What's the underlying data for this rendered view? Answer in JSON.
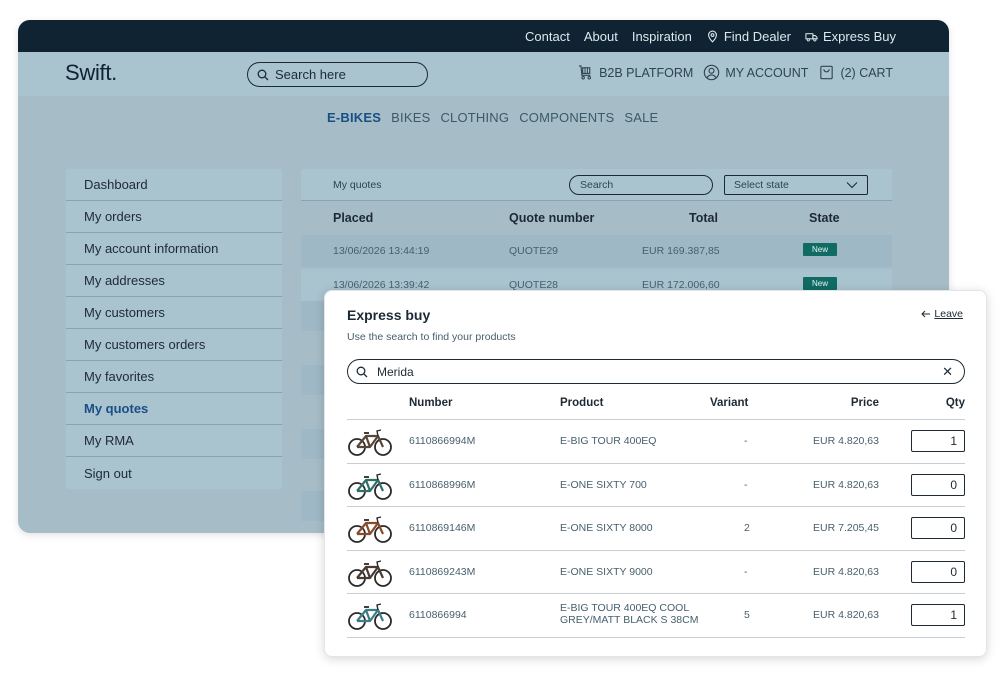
{
  "topnav": {
    "links": [
      {
        "label": "Contact",
        "icon": ""
      },
      {
        "label": "About",
        "icon": ""
      },
      {
        "label": "Inspiration",
        "icon": ""
      },
      {
        "label": "Find Dealer",
        "icon": "location-pin-icon"
      },
      {
        "label": "Express Buy",
        "icon": "truck-icon"
      }
    ]
  },
  "header": {
    "logo": "Swift.",
    "search_placeholder": "Search here",
    "b2b_label": "B2B PLATFORM",
    "account_label": "MY ACCOUNT",
    "cart_label": "(2) CART"
  },
  "categories": [
    {
      "label": "E-BIKES",
      "active": true
    },
    {
      "label": "BIKES",
      "active": false
    },
    {
      "label": "CLOTHING",
      "active": false
    },
    {
      "label": "COMPONENTS",
      "active": false
    },
    {
      "label": "SALE",
      "active": false
    }
  ],
  "sidebar": {
    "items": [
      {
        "label": "Dashboard"
      },
      {
        "label": "My orders"
      },
      {
        "label": "My account information"
      },
      {
        "label": "My addresses"
      },
      {
        "label": "My customers"
      },
      {
        "label": "My customers orders"
      },
      {
        "label": "My favorites"
      },
      {
        "label": "My quotes",
        "active": true
      },
      {
        "label": "My RMA"
      },
      {
        "label": "Sign out"
      }
    ]
  },
  "quotes": {
    "title": "My quotes",
    "search_placeholder": "Search",
    "select_placeholder": "Select state",
    "columns": {
      "placed": "Placed",
      "number": "Quote number",
      "total": "Total",
      "state": "State"
    },
    "rows": [
      {
        "placed": "13/06/2026 13:44:19",
        "number": "QUOTE29",
        "total": "EUR 169.387,85",
        "state": "New"
      },
      {
        "placed": "13/06/2026 13:39:42",
        "number": "QUOTE28",
        "total": "EUR 172.006,60",
        "state": "New"
      }
    ]
  },
  "express": {
    "title": "Express buy",
    "subtitle": "Use the search to find your products",
    "leave_label": "Leave",
    "search_value": "Merida",
    "columns": {
      "number": "Number",
      "product": "Product",
      "variant": "Variant",
      "price": "Price",
      "qty": "Qty"
    },
    "rows": [
      {
        "number": "6110866994M",
        "product": "E-BIG TOUR 400EQ",
        "product2": "",
        "variant": "-",
        "price": "EUR 4.820,63",
        "qty": "1",
        "bike_color": "#5a4638"
      },
      {
        "number": "6110868996M",
        "product": "E-ONE SIXTY 700",
        "product2": "",
        "variant": "-",
        "price": "EUR 4.820,63",
        "qty": "0",
        "bike_color": "#2f6f6a"
      },
      {
        "number": "6110869146M",
        "product": "E-ONE SIXTY 8000",
        "product2": "",
        "variant": "2",
        "price": "EUR 7.205,45",
        "qty": "0",
        "bike_color": "#8a4a2c"
      },
      {
        "number": "6110869243M",
        "product": "E-ONE SIXTY 9000",
        "product2": "",
        "variant": "-",
        "price": "EUR 4.820,63",
        "qty": "0",
        "bike_color": "#4a3a30"
      },
      {
        "number": "6110866994",
        "product": "E-BIG TOUR 400EQ COOL",
        "product2": "GREY/MATT BLACK S 38CM",
        "variant": "5",
        "price": "EUR 4.820,63",
        "qty": "1",
        "bike_color": "#3b7c86"
      }
    ]
  },
  "colors": {
    "accent": "#1a4f86",
    "topbar": "#0f2332",
    "badge": "#0f6b64"
  }
}
